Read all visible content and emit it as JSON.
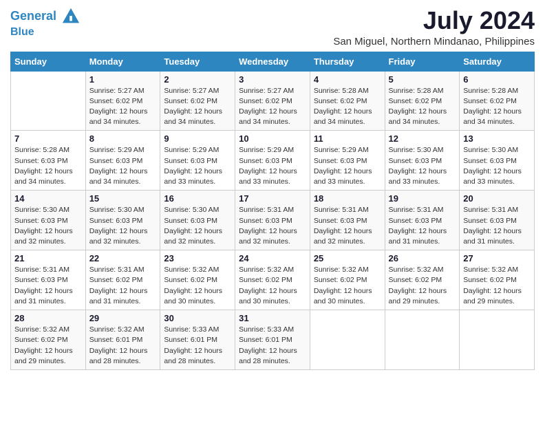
{
  "logo": {
    "line1": "General",
    "line2": "Blue"
  },
  "title": "July 2024",
  "subtitle": "San Miguel, Northern Mindanao, Philippines",
  "header": {
    "colors": {
      "accent": "#2e86c1"
    }
  },
  "weekdays": [
    "Sunday",
    "Monday",
    "Tuesday",
    "Wednesday",
    "Thursday",
    "Friday",
    "Saturday"
  ],
  "weeks": [
    [
      {
        "day": "",
        "sunrise": "",
        "sunset": "",
        "daylight": ""
      },
      {
        "day": "1",
        "sunrise": "5:27 AM",
        "sunset": "6:02 PM",
        "daylight": "12 hours and 34 minutes."
      },
      {
        "day": "2",
        "sunrise": "5:27 AM",
        "sunset": "6:02 PM",
        "daylight": "12 hours and 34 minutes."
      },
      {
        "day": "3",
        "sunrise": "5:27 AM",
        "sunset": "6:02 PM",
        "daylight": "12 hours and 34 minutes."
      },
      {
        "day": "4",
        "sunrise": "5:28 AM",
        "sunset": "6:02 PM",
        "daylight": "12 hours and 34 minutes."
      },
      {
        "day": "5",
        "sunrise": "5:28 AM",
        "sunset": "6:02 PM",
        "daylight": "12 hours and 34 minutes."
      },
      {
        "day": "6",
        "sunrise": "5:28 AM",
        "sunset": "6:02 PM",
        "daylight": "12 hours and 34 minutes."
      }
    ],
    [
      {
        "day": "7",
        "sunrise": "5:28 AM",
        "sunset": "6:03 PM",
        "daylight": "12 hours and 34 minutes."
      },
      {
        "day": "8",
        "sunrise": "5:29 AM",
        "sunset": "6:03 PM",
        "daylight": "12 hours and 34 minutes."
      },
      {
        "day": "9",
        "sunrise": "5:29 AM",
        "sunset": "6:03 PM",
        "daylight": "12 hours and 33 minutes."
      },
      {
        "day": "10",
        "sunrise": "5:29 AM",
        "sunset": "6:03 PM",
        "daylight": "12 hours and 33 minutes."
      },
      {
        "day": "11",
        "sunrise": "5:29 AM",
        "sunset": "6:03 PM",
        "daylight": "12 hours and 33 minutes."
      },
      {
        "day": "12",
        "sunrise": "5:30 AM",
        "sunset": "6:03 PM",
        "daylight": "12 hours and 33 minutes."
      },
      {
        "day": "13",
        "sunrise": "5:30 AM",
        "sunset": "6:03 PM",
        "daylight": "12 hours and 33 minutes."
      }
    ],
    [
      {
        "day": "14",
        "sunrise": "5:30 AM",
        "sunset": "6:03 PM",
        "daylight": "12 hours and 32 minutes."
      },
      {
        "day": "15",
        "sunrise": "5:30 AM",
        "sunset": "6:03 PM",
        "daylight": "12 hours and 32 minutes."
      },
      {
        "day": "16",
        "sunrise": "5:30 AM",
        "sunset": "6:03 PM",
        "daylight": "12 hours and 32 minutes."
      },
      {
        "day": "17",
        "sunrise": "5:31 AM",
        "sunset": "6:03 PM",
        "daylight": "12 hours and 32 minutes."
      },
      {
        "day": "18",
        "sunrise": "5:31 AM",
        "sunset": "6:03 PM",
        "daylight": "12 hours and 32 minutes."
      },
      {
        "day": "19",
        "sunrise": "5:31 AM",
        "sunset": "6:03 PM",
        "daylight": "12 hours and 31 minutes."
      },
      {
        "day": "20",
        "sunrise": "5:31 AM",
        "sunset": "6:03 PM",
        "daylight": "12 hours and 31 minutes."
      }
    ],
    [
      {
        "day": "21",
        "sunrise": "5:31 AM",
        "sunset": "6:03 PM",
        "daylight": "12 hours and 31 minutes."
      },
      {
        "day": "22",
        "sunrise": "5:31 AM",
        "sunset": "6:02 PM",
        "daylight": "12 hours and 31 minutes."
      },
      {
        "day": "23",
        "sunrise": "5:32 AM",
        "sunset": "6:02 PM",
        "daylight": "12 hours and 30 minutes."
      },
      {
        "day": "24",
        "sunrise": "5:32 AM",
        "sunset": "6:02 PM",
        "daylight": "12 hours and 30 minutes."
      },
      {
        "day": "25",
        "sunrise": "5:32 AM",
        "sunset": "6:02 PM",
        "daylight": "12 hours and 30 minutes."
      },
      {
        "day": "26",
        "sunrise": "5:32 AM",
        "sunset": "6:02 PM",
        "daylight": "12 hours and 29 minutes."
      },
      {
        "day": "27",
        "sunrise": "5:32 AM",
        "sunset": "6:02 PM",
        "daylight": "12 hours and 29 minutes."
      }
    ],
    [
      {
        "day": "28",
        "sunrise": "5:32 AM",
        "sunset": "6:02 PM",
        "daylight": "12 hours and 29 minutes."
      },
      {
        "day": "29",
        "sunrise": "5:32 AM",
        "sunset": "6:01 PM",
        "daylight": "12 hours and 28 minutes."
      },
      {
        "day": "30",
        "sunrise": "5:33 AM",
        "sunset": "6:01 PM",
        "daylight": "12 hours and 28 minutes."
      },
      {
        "day": "31",
        "sunrise": "5:33 AM",
        "sunset": "6:01 PM",
        "daylight": "12 hours and 28 minutes."
      },
      {
        "day": "",
        "sunrise": "",
        "sunset": "",
        "daylight": ""
      },
      {
        "day": "",
        "sunrise": "",
        "sunset": "",
        "daylight": ""
      },
      {
        "day": "",
        "sunrise": "",
        "sunset": "",
        "daylight": ""
      }
    ]
  ],
  "labels": {
    "sunrise_prefix": "Sunrise: ",
    "sunset_prefix": "Sunset: ",
    "daylight_prefix": "Daylight: "
  }
}
